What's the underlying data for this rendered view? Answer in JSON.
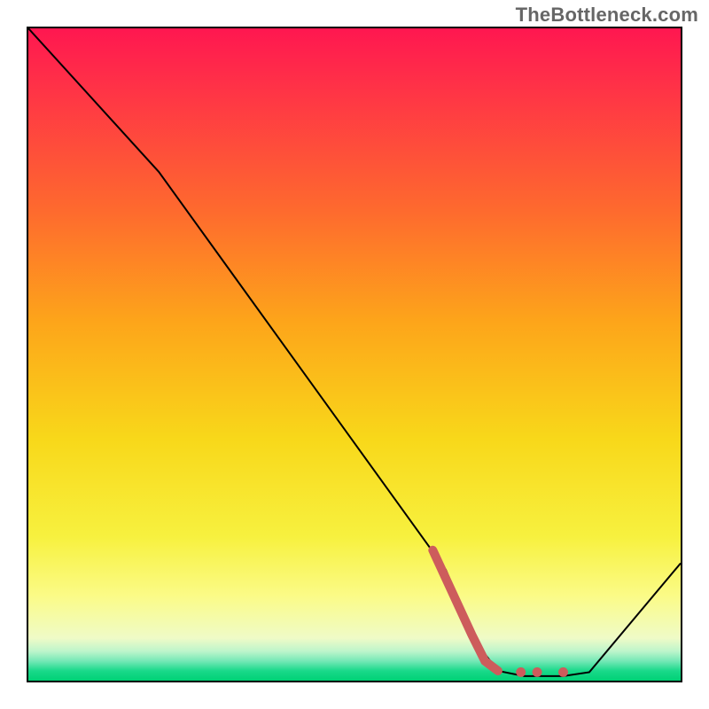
{
  "watermark": "TheBottleneck.com",
  "chart_data": {
    "type": "line",
    "title": "",
    "xlabel": "",
    "ylabel": "",
    "xlim": [
      0,
      100
    ],
    "ylim": [
      0,
      100
    ],
    "series": [
      {
        "name": "bottleneck-curve",
        "color": "#000000",
        "stroke_width": 2,
        "points": [
          {
            "x": 0,
            "y": 100
          },
          {
            "x": 20,
            "y": 78
          },
          {
            "x": 64,
            "y": 17
          },
          {
            "x": 68.5,
            "y": 6
          },
          {
            "x": 72,
            "y": 1.5
          },
          {
            "x": 76,
            "y": 0.7
          },
          {
            "x": 82,
            "y": 0.7
          },
          {
            "x": 86,
            "y": 1.3
          },
          {
            "x": 100,
            "y": 18
          }
        ]
      },
      {
        "name": "highlight-segment",
        "color": "#CD5C5C",
        "stroke_width": 10,
        "linecap": "round",
        "points": [
          {
            "x": 62,
            "y": 20
          },
          {
            "x": 68,
            "y": 7
          },
          {
            "x": 70,
            "y": 3
          },
          {
            "x": 72,
            "y": 1.5
          }
        ]
      }
    ],
    "highlight_dots": {
      "color": "#CD5C5C",
      "radius": 5.5,
      "points": [
        {
          "x": 75.5,
          "y": 1.3
        },
        {
          "x": 78,
          "y": 1.3
        },
        {
          "x": 82,
          "y": 1.3
        }
      ]
    },
    "gradient_stops": [
      {
        "offset": 0,
        "color": "#FF1750"
      },
      {
        "offset": 0.28,
        "color": "#FE6A2E"
      },
      {
        "offset": 0.63,
        "color": "#F8D81A"
      },
      {
        "offset": 0.87,
        "color": "#FBFB87"
      },
      {
        "offset": 0.955,
        "color": "#BDF5CB"
      },
      {
        "offset": 1.0,
        "color": "#00D175"
      }
    ]
  }
}
